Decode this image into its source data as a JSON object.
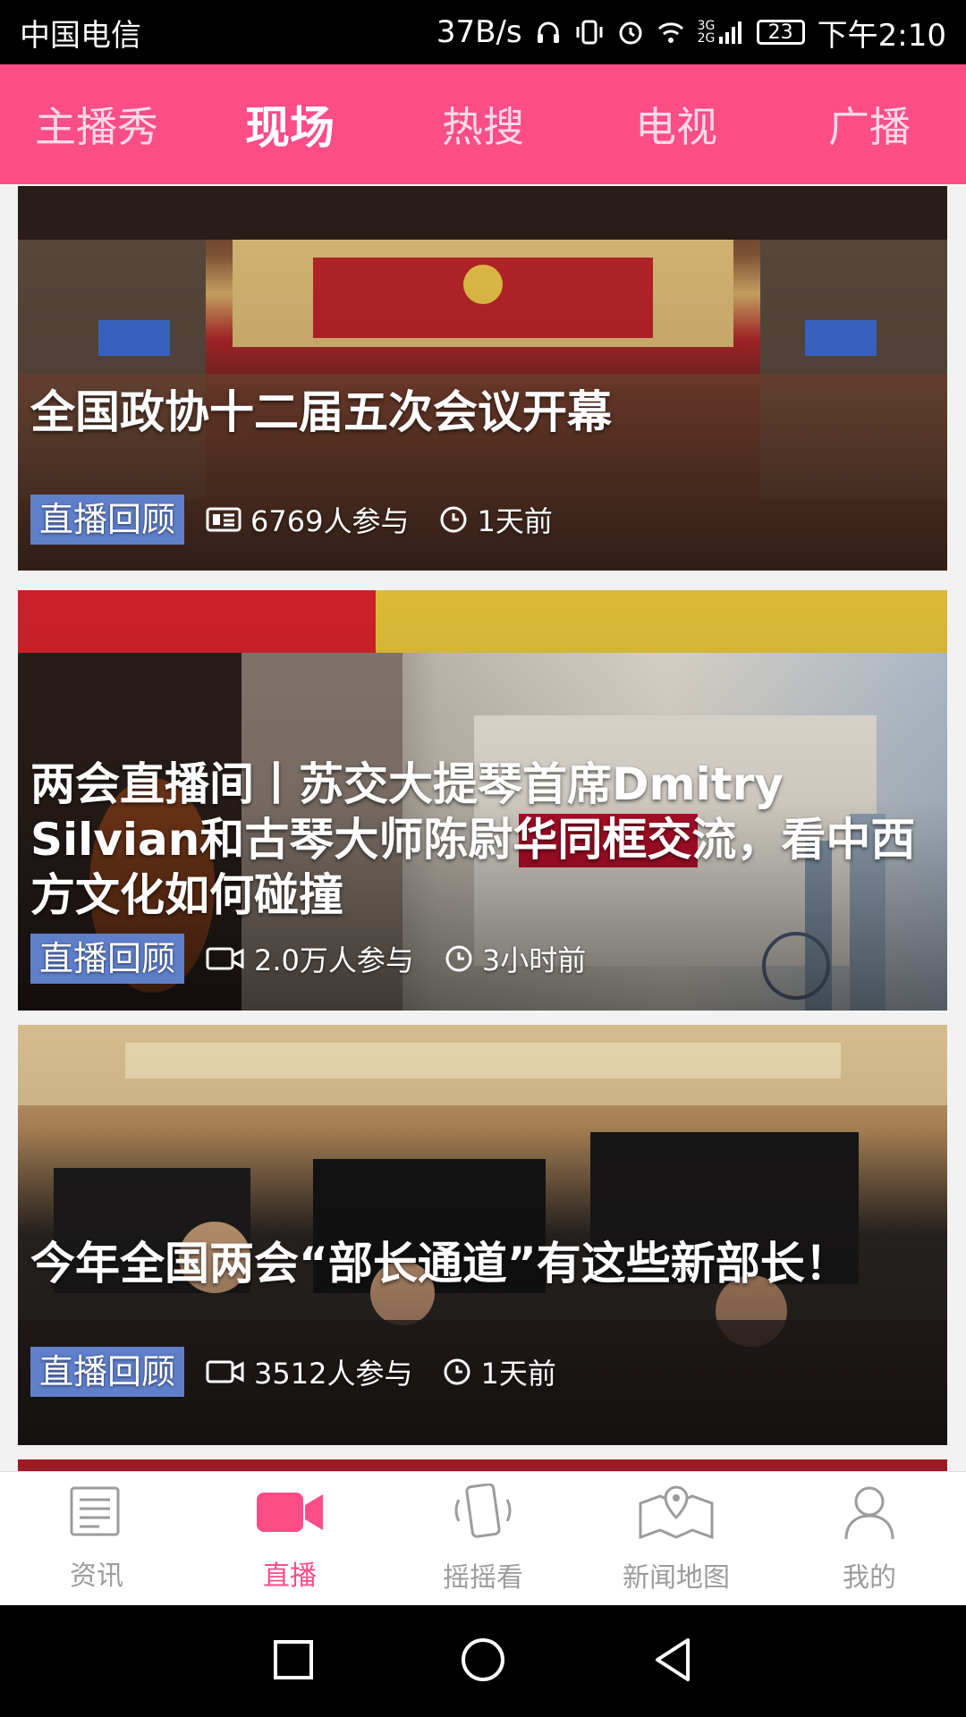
{
  "status_bar": {
    "carrier": "中国电信",
    "net_speed": "37B/s",
    "network_type": "3G 2G",
    "battery": "23",
    "time": "下午2:10"
  },
  "top_tabs": [
    {
      "label": "主播秀"
    },
    {
      "label": "现场"
    },
    {
      "label": "热搜"
    },
    {
      "label": "电视"
    },
    {
      "label": "广播"
    }
  ],
  "active_tab": "现场",
  "feed": [
    {
      "title": "全国政协十二届五次会议开幕",
      "badge": "直播回顾",
      "participants": "6769人参与",
      "time": "1天前",
      "meta_icon": "news-icon"
    },
    {
      "title": "两会直播间丨苏交大提琴首席Dmitry Silvian和古琴大师陈尉华同框交流，看中西方文化如何碰撞",
      "badge": "直播回顾",
      "participants": "2.0万人参与",
      "time": "3小时前",
      "meta_icon": "video-icon"
    },
    {
      "title": "今年全国两会“部长通道”有这些新部长！",
      "badge": "直播回顾",
      "participants": "3512人参与",
      "time": "1天前",
      "meta_icon": "video-icon"
    }
  ],
  "bottom_nav": [
    {
      "label": "资讯",
      "icon": "news-icon"
    },
    {
      "label": "直播",
      "icon": "camera-icon"
    },
    {
      "label": "摇摇看",
      "icon": "shake-phone-icon"
    },
    {
      "label": "新闻地图",
      "icon": "map-icon"
    },
    {
      "label": "我的",
      "icon": "profile-icon"
    }
  ],
  "active_bottom": "直播",
  "colors": {
    "accent": "#fb4d86",
    "badge": "#5f7fcb"
  }
}
